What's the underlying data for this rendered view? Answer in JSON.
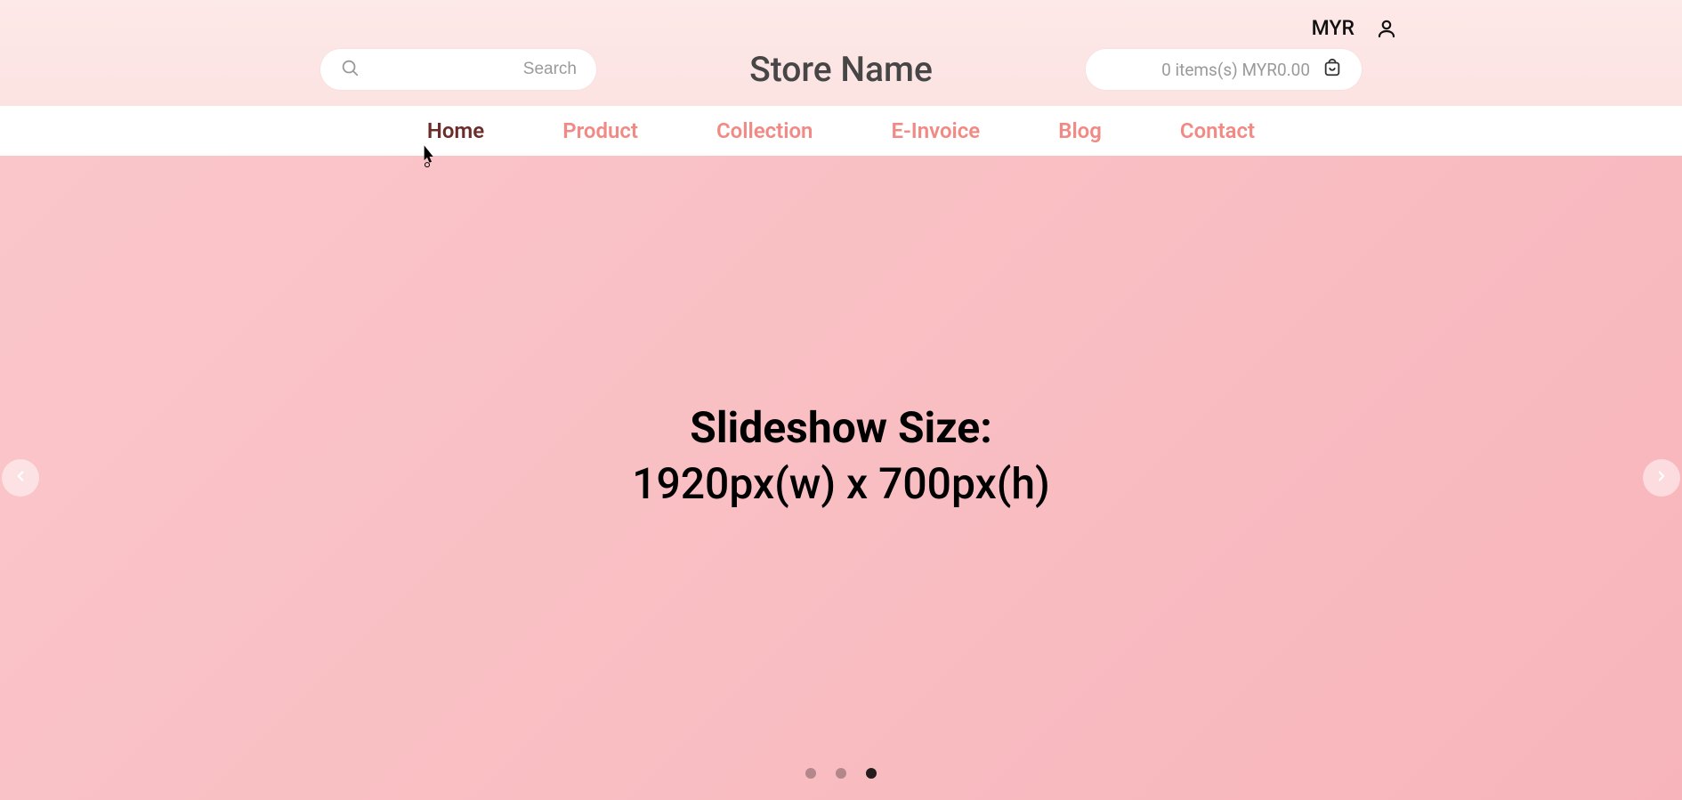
{
  "top": {
    "currency": "MYR"
  },
  "header": {
    "store_name": "Store Name",
    "search_placeholder": "Search",
    "cart_label": "0 items(s) MYR0.00"
  },
  "nav": {
    "items": [
      {
        "label": "Home",
        "active": true
      },
      {
        "label": "Product",
        "active": false
      },
      {
        "label": "Collection",
        "active": false
      },
      {
        "label": "E-Invoice",
        "active": false
      },
      {
        "label": "Blog",
        "active": false
      },
      {
        "label": "Contact",
        "active": false
      }
    ]
  },
  "slideshow": {
    "title": "Slideshow Size:",
    "subtitle": "1920px(w) x 700px(h)",
    "dots": 3,
    "active_dot": 2
  }
}
